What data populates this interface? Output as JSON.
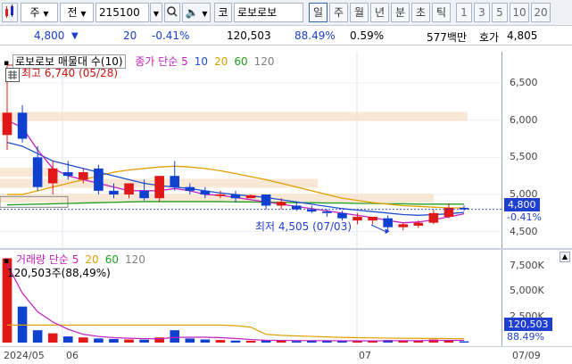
{
  "toolbar": {
    "market_selector": "주",
    "period_kind": "전",
    "code": "215100",
    "search_icon": "search-icon",
    "stock_name_prefix": "코",
    "stock_name": "로보로보",
    "periods": [
      "일",
      "주",
      "월",
      "년",
      "분",
      "초",
      "틱"
    ],
    "active_period": "일",
    "counts": [
      "1",
      "3",
      "5",
      "10",
      "20"
    ]
  },
  "price_info": {
    "price": "4,800",
    "change": "20",
    "change_rate": "-0.41%",
    "volume": "120,503",
    "volume_ratio": "88.49%",
    "turnover_rate": "0.59%",
    "amount": "577백만",
    "ask_label": "호가",
    "ask_price": "4,805"
  },
  "price_chart": {
    "legend_box_label": "로보로보 매물대 수(10)",
    "legend_items": [
      {
        "label": "종가 단순 5",
        "color": "#c020c0"
      },
      {
        "label": "10",
        "color": "#2050d0"
      },
      {
        "label": "20",
        "color": "#e0a000"
      },
      {
        "label": "60",
        "color": "#20a020"
      },
      {
        "label": "120",
        "color": "#808080"
      }
    ],
    "high_marker": "최고 6,740 (05/28)",
    "low_marker": "최저 4,505 (07/03)",
    "y_ticks": [
      "6,500",
      "6,000",
      "5,500",
      "5,000",
      "4,500"
    ],
    "current_price_tag": "4,800",
    "current_rate_tag": "-0.41%"
  },
  "volume_chart": {
    "legend_items": [
      {
        "label": "거래량 단순 5",
        "color": "#c020c0"
      },
      {
        "label": "20",
        "color": "#e0a000"
      },
      {
        "label": "60",
        "color": "#20a020"
      },
      {
        "label": "120",
        "color": "#808080"
      }
    ],
    "volume_text": "120,503주(88,49%)",
    "y_ticks": [
      "7,500K",
      "5,000K",
      "2,500K"
    ],
    "current_volume_tag": "120,503",
    "current_ratio_tag": "88.49%"
  },
  "x_axis": {
    "labels": [
      "2024/05",
      "06",
      "07",
      "07/09"
    ]
  },
  "chart_data": [
    {
      "type": "candlestick",
      "title": "로보로보",
      "ylim": [
        4400,
        6800
      ],
      "candles": [
        {
          "o": 5800,
          "h": 6740,
          "l": 5600,
          "c": 6100
        },
        {
          "o": 6100,
          "h": 6200,
          "l": 5700,
          "c": 5750
        },
        {
          "o": 5500,
          "h": 5650,
          "l": 5050,
          "c": 5100
        },
        {
          "o": 5150,
          "h": 5450,
          "l": 5000,
          "c": 5350
        },
        {
          "o": 5300,
          "h": 5450,
          "l": 5200,
          "c": 5250
        },
        {
          "o": 5200,
          "h": 5350,
          "l": 5150,
          "c": 5300
        },
        {
          "o": 5350,
          "h": 5400,
          "l": 5000,
          "c": 5050
        },
        {
          "o": 5050,
          "h": 5150,
          "l": 4950,
          "c": 5000
        },
        {
          "o": 5000,
          "h": 5150,
          "l": 4950,
          "c": 5150
        },
        {
          "o": 5050,
          "h": 5200,
          "l": 4920,
          "c": 4950
        },
        {
          "o": 4950,
          "h": 5250,
          "l": 4900,
          "c": 5250
        },
        {
          "o": 5250,
          "h": 5450,
          "l": 5050,
          "c": 5100
        },
        {
          "o": 5100,
          "h": 5150,
          "l": 5000,
          "c": 5050
        },
        {
          "o": 5050,
          "h": 5100,
          "l": 4950,
          "c": 5000
        },
        {
          "o": 4980,
          "h": 5050,
          "l": 4950,
          "c": 5000
        },
        {
          "o": 5000,
          "h": 5050,
          "l": 4900,
          "c": 4950
        },
        {
          "o": 4950,
          "h": 5000,
          "l": 4950,
          "c": 4990
        },
        {
          "o": 5000,
          "h": 5000,
          "l": 4800,
          "c": 4850
        },
        {
          "o": 4850,
          "h": 4950,
          "l": 4800,
          "c": 4900
        },
        {
          "o": 4850,
          "h": 4900,
          "l": 4780,
          "c": 4800
        },
        {
          "o": 4800,
          "h": 4850,
          "l": 4750,
          "c": 4770
        },
        {
          "o": 4770,
          "h": 4800,
          "l": 4700,
          "c": 4750
        },
        {
          "o": 4750,
          "h": 4780,
          "l": 4650,
          "c": 4680
        },
        {
          "o": 4650,
          "h": 4750,
          "l": 4600,
          "c": 4700
        },
        {
          "o": 4650,
          "h": 4700,
          "l": 4600,
          "c": 4700
        },
        {
          "o": 4680,
          "h": 4720,
          "l": 4505,
          "c": 4560
        },
        {
          "o": 4560,
          "h": 4620,
          "l": 4520,
          "c": 4600
        },
        {
          "o": 4580,
          "h": 4650,
          "l": 4550,
          "c": 4620
        },
        {
          "o": 4620,
          "h": 4800,
          "l": 4600,
          "c": 4750
        },
        {
          "o": 4700,
          "h": 4880,
          "l": 4680,
          "c": 4820
        },
        {
          "o": 4820,
          "h": 4850,
          "l": 4780,
          "c": 4800
        }
      ],
      "ma5": [
        6000,
        5900,
        5600,
        5350,
        5250,
        5200,
        5150,
        5100,
        5050,
        5050,
        5050,
        5080,
        5050,
        5000,
        4990,
        4960,
        4930,
        4900,
        4870,
        4840,
        4810,
        4780,
        4750,
        4720,
        4690,
        4650,
        4620,
        4630,
        4660,
        4700,
        4740
      ],
      "ma10": [
        5700,
        5650,
        5550,
        5450,
        5400,
        5350,
        5300,
        5250,
        5200,
        5150,
        5120,
        5100,
        5080,
        5050,
        5020,
        5000,
        4980,
        4960,
        4930,
        4900,
        4870,
        4840,
        4810,
        4790,
        4770,
        4750,
        4730,
        4720,
        4730,
        4740,
        4760
      ],
      "ma20": [
        5000,
        5000,
        5050,
        5100,
        5150,
        5200,
        5250,
        5300,
        5330,
        5350,
        5370,
        5380,
        5370,
        5350,
        5320,
        5280,
        5240,
        5200,
        5150,
        5100,
        5050,
        5000,
        4950,
        4920,
        4890,
        4870,
        4850,
        4840,
        4830,
        4820,
        4820
      ],
      "ma60": [
        4860,
        4865,
        4870,
        4875,
        4880,
        4885,
        4890,
        4895,
        4900,
        4905,
        4905,
        4905,
        4905,
        4905,
        4905,
        4900,
        4900,
        4895,
        4895,
        4890,
        4890,
        4885,
        4885,
        4880,
        4880,
        4875,
        4875,
        4870,
        4870,
        4870,
        4870
      ],
      "volume_profile": [
        {
          "price": 6050,
          "strength": 0.97
        },
        {
          "price": 5300,
          "strength": 0.12
        },
        {
          "price": 5150,
          "strength": 0.66
        },
        {
          "price": 4950,
          "strength": 0.9
        }
      ]
    },
    {
      "type": "bar",
      "title": "거래량",
      "ylim": [
        0,
        8500
      ],
      "values": [
        8200,
        3500,
        1200,
        900,
        600,
        500,
        400,
        350,
        300,
        280,
        500,
        1200,
        400,
        300,
        250,
        200,
        180,
        220,
        200,
        150,
        180,
        200,
        160,
        140,
        150,
        250,
        200,
        180,
        300,
        250,
        120
      ],
      "ma5": [
        7600,
        4800,
        3000,
        2000,
        1300,
        800,
        600,
        480,
        420,
        380,
        370,
        500,
        520,
        520,
        480,
        400,
        300,
        230,
        210,
        200,
        190,
        190,
        180,
        175,
        170,
        180,
        190,
        190,
        210,
        220,
        220
      ],
      "ma20": [
        1700,
        1700,
        1700,
        1700,
        1700,
        1700,
        1700,
        1700,
        1700,
        1700,
        1700,
        1700,
        1700,
        1700,
        1700,
        1650,
        1500,
        800,
        700,
        650,
        600,
        550,
        500,
        480,
        460,
        440,
        420,
        410,
        400,
        390,
        380
      ]
    }
  ]
}
